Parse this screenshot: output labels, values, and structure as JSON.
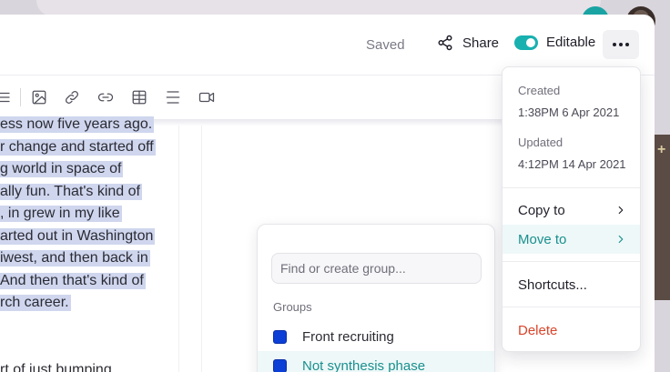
{
  "header": {
    "status": "Saved",
    "share_label": "Share",
    "editable_label": "Editable",
    "editable_on": true
  },
  "toolbar": {
    "tools": [
      "list-icon",
      "image-icon",
      "link-icon",
      "link-alt-icon",
      "table-icon",
      "divider-icon",
      "video-icon"
    ]
  },
  "document": {
    "highlighted_lines": [
      "ess now five years ago.",
      "r change and started off",
      "g world in space of",
      "ally fun. That's kind of",
      ", in grew in my like",
      "arted out in Washington",
      "iwest, and then back in",
      "And then that's kind of",
      "rch career."
    ],
    "trailing_line": "rt of just bumping"
  },
  "group_picker": {
    "search_placeholder": "Find or create group...",
    "heading": "Groups",
    "groups": [
      {
        "label": "Front recruiting",
        "color": "#0b3fd6",
        "active": false
      },
      {
        "label": "Not synthesis phase",
        "color": "#0b3fd6",
        "active": true
      }
    ]
  },
  "more_menu": {
    "created_label": "Created",
    "created_value": "1:38PM 6 Apr 2021",
    "updated_label": "Updated",
    "updated_value": "4:12PM 14 Apr 2021",
    "copy_to": "Copy to",
    "move_to": "Move to",
    "shortcuts": "Shortcuts...",
    "delete": "Delete"
  },
  "colors": {
    "accent": "#19b0b0",
    "danger": "#d9442a",
    "highlight": "#cfd6ee",
    "group_swatch": "#0b3fd6"
  }
}
